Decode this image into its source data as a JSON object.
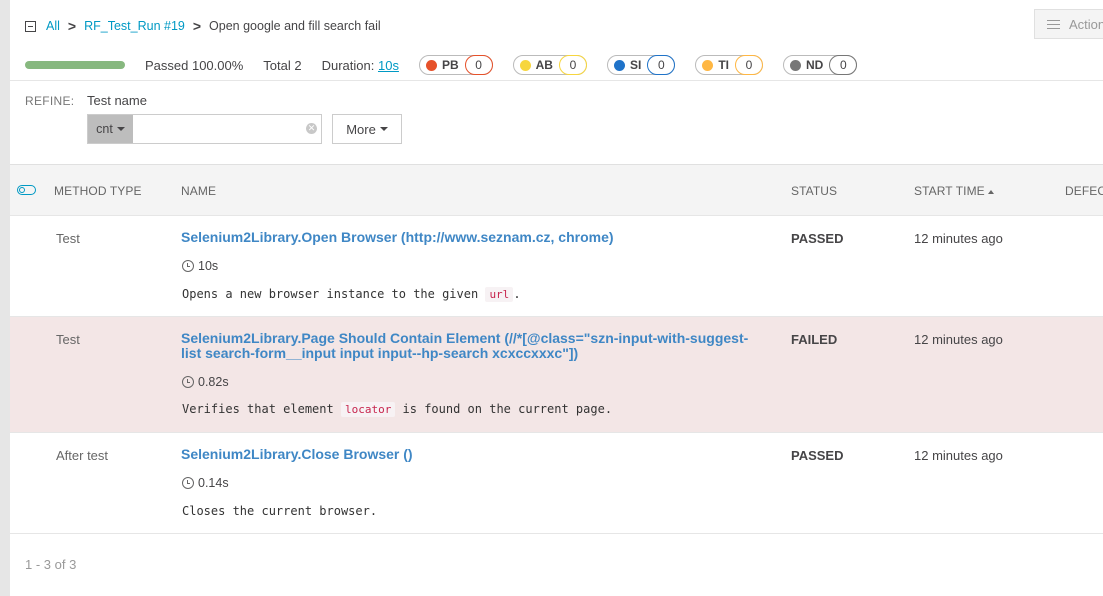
{
  "breadcrumb": {
    "root": "All",
    "launch": "RF_Test_Run #19",
    "current": "Open google and fill search fail",
    "separator": ">"
  },
  "actions": {
    "label": "Actions"
  },
  "summary": {
    "progress_percent": 100,
    "passed_text": "Passed 100.00%",
    "total_text": "Total 2",
    "duration_label": "Duration:",
    "duration_value": "10s",
    "defects": [
      {
        "label": "PB",
        "count": "0",
        "color": "#e6512a"
      },
      {
        "label": "AB",
        "count": "0",
        "color": "#f7d63e"
      },
      {
        "label": "SI",
        "count": "0",
        "color": "#1f73c9"
      },
      {
        "label": "TI",
        "count": "0",
        "color": "#ffb743"
      },
      {
        "label": "ND",
        "count": "0",
        "color": "#777777"
      }
    ]
  },
  "refine": {
    "label": "REFINE:",
    "field_label": "Test name",
    "condition": "cnt",
    "value": "",
    "more_label": "More"
  },
  "table": {
    "headers": {
      "method_type": "METHOD TYPE",
      "name": "NAME",
      "status": "STATUS",
      "start_time": "START TIME",
      "defect": "DEFECT TYPE"
    },
    "rows": [
      {
        "type": "Test",
        "name": "Selenium2Library.Open Browser (http://www.seznam.cz, chrome)",
        "duration": "10s",
        "desc_before": "Opens a new browser instance to the given ",
        "desc_code": "url",
        "desc_after": ".",
        "status": "PASSED",
        "time": "12 minutes ago"
      },
      {
        "type": "Test",
        "name": "Selenium2Library.Page Should Contain Element (//*[@class=\"szn-input-with-suggest-list search-form__input input input--hp-search xcxccxxxc\"])",
        "duration": "0.82s",
        "desc_before": "Verifies that element ",
        "desc_code": "locator",
        "desc_after": " is found on the current page.",
        "status": "FAILED",
        "time": "12 minutes ago"
      },
      {
        "type": "After test",
        "name": "Selenium2Library.Close Browser ()",
        "duration": "0.14s",
        "desc_before": "Closes the current browser.",
        "desc_code": "",
        "desc_after": "",
        "status": "PASSED",
        "time": "12 minutes ago"
      }
    ]
  },
  "pager": {
    "text": "1 - 3 of 3"
  },
  "colors": {
    "link": "#0099c4",
    "name_link": "#3f87c5",
    "failed_row": "#f3e6e6",
    "progress": "#87b87f"
  }
}
